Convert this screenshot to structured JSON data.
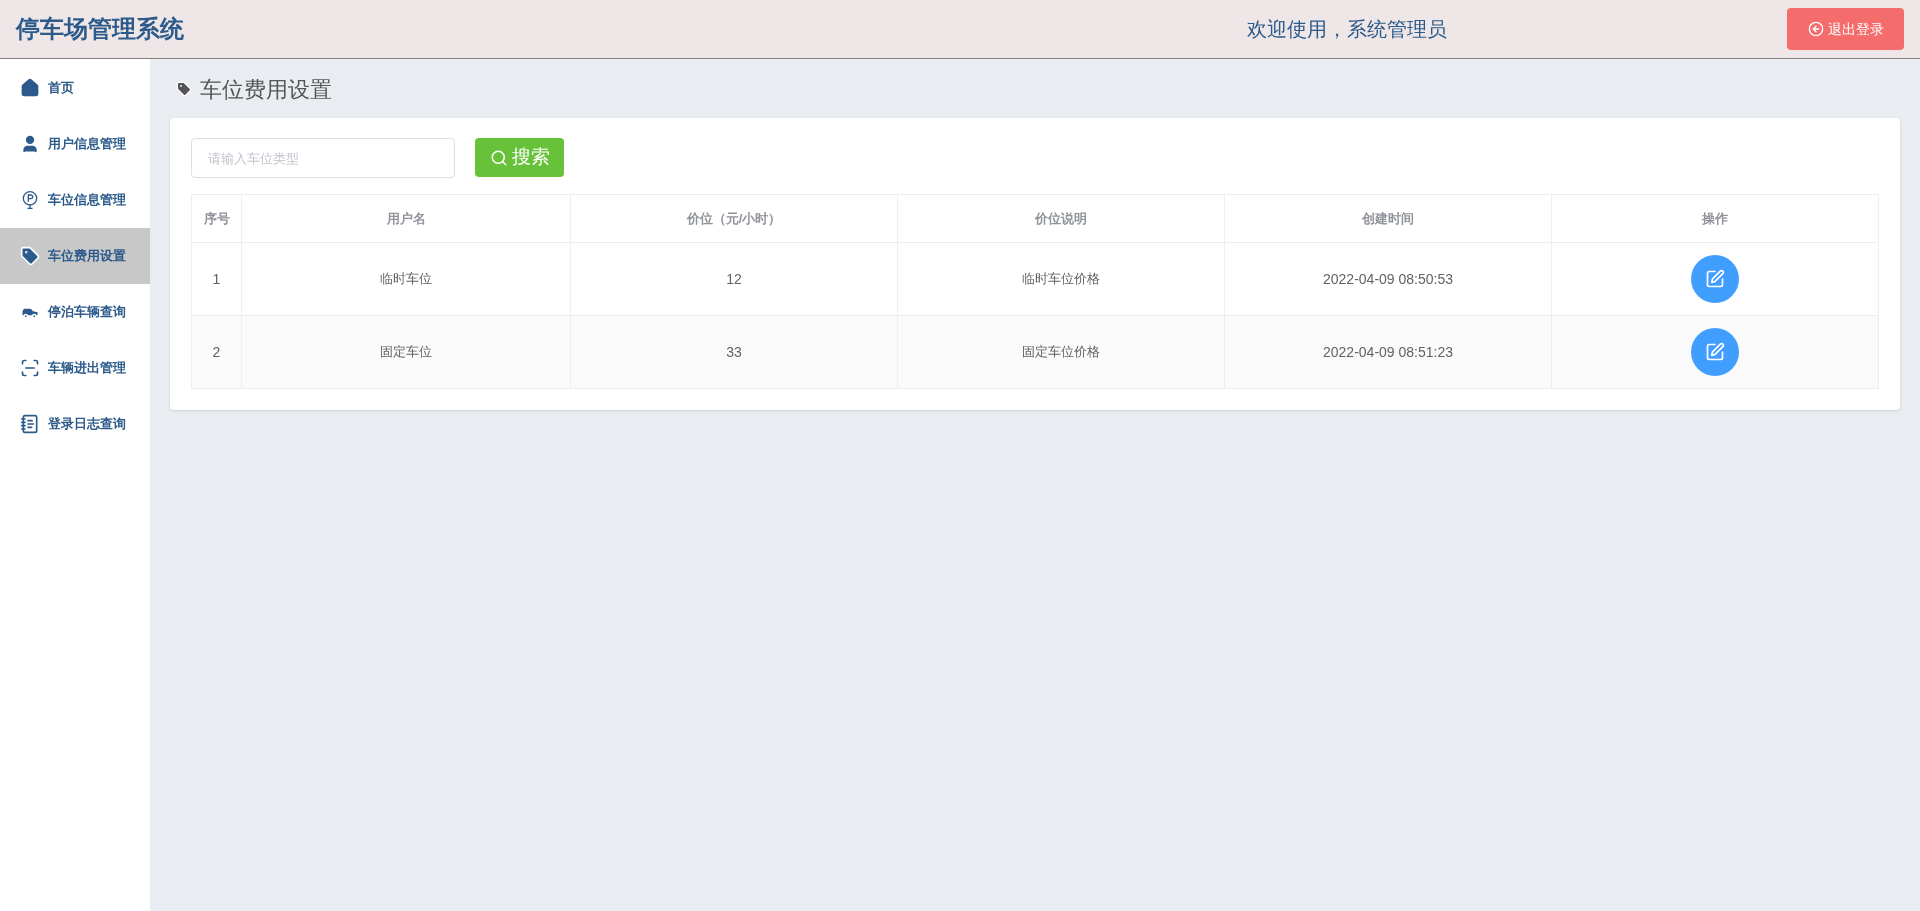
{
  "header": {
    "title": "停车场管理系统",
    "welcome": "欢迎使用，系统管理员",
    "logout": "退出登录"
  },
  "sidebar": {
    "items": [
      {
        "label": "首页",
        "selected": false
      },
      {
        "label": "用户信息管理",
        "selected": false
      },
      {
        "label": "车位信息管理",
        "selected": false
      },
      {
        "label": "车位费用设置",
        "selected": true
      },
      {
        "label": "停泊车辆查询",
        "selected": false
      },
      {
        "label": "车辆进出管理",
        "selected": false
      },
      {
        "label": "登录日志查询",
        "selected": false
      }
    ]
  },
  "page": {
    "title": "车位费用设置"
  },
  "search": {
    "placeholder": "请输入车位类型",
    "button": "搜索"
  },
  "table": {
    "columns": [
      "序号",
      "用户名",
      "价位（元/小时）",
      "价位说明",
      "创建时间",
      "操作"
    ],
    "rows": [
      {
        "index": "1",
        "name": "临时车位",
        "price": "12",
        "description": "临时车位价格",
        "created": "2022-04-09 08:50:53"
      },
      {
        "index": "2",
        "name": "固定车位",
        "price": "33",
        "description": "固定车位价格",
        "created": "2022-04-09 08:51:23"
      }
    ]
  }
}
